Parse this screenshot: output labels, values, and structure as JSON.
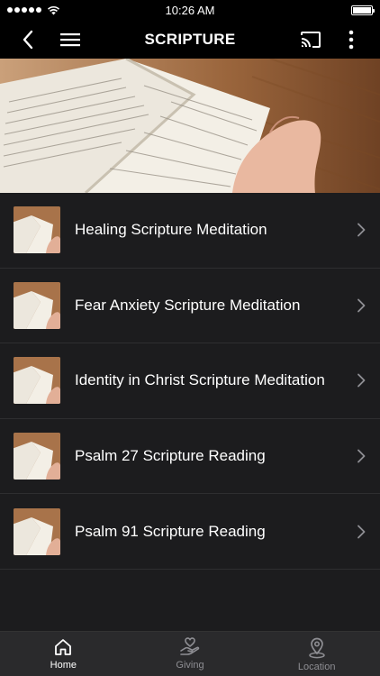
{
  "status_bar": {
    "time": "10:26 AM"
  },
  "nav": {
    "title": "SCRIPTURE"
  },
  "list": {
    "items": [
      {
        "label": "Healing Scripture Meditation"
      },
      {
        "label": "Fear Anxiety Scripture Meditation"
      },
      {
        "label": "Identity in Christ Scripture Meditation"
      },
      {
        "label": "Psalm 27 Scripture Reading"
      },
      {
        "label": "Psalm 91 Scripture Reading"
      }
    ]
  },
  "tabs": [
    {
      "label": "Home",
      "icon": "home-icon",
      "active": true
    },
    {
      "label": "Giving",
      "icon": "giving-icon",
      "active": false
    },
    {
      "label": "Location",
      "icon": "location-pin-icon",
      "active": false
    }
  ],
  "colors": {
    "background": "#1c1c1e",
    "bar": "#000000",
    "tab_bar": "#2a2a2c",
    "inactive": "#8e8e93"
  }
}
